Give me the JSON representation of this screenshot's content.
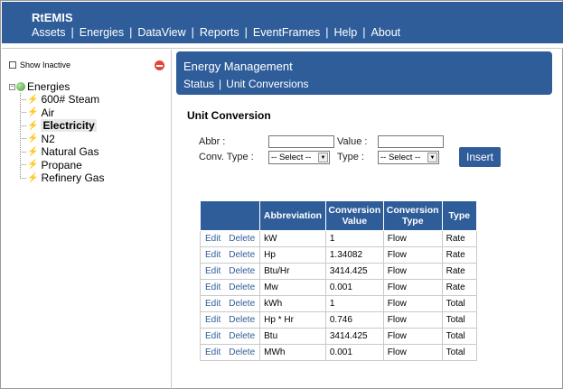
{
  "app": {
    "title": "RtEMIS",
    "nav": [
      "Assets",
      "Energies",
      "DataView",
      "Reports",
      "EventFrames",
      "Help",
      "About"
    ]
  },
  "sidebar": {
    "show_inactive_label": "Show Inactive",
    "tree_root": "Energies",
    "items": [
      "600# Steam",
      "Air",
      "Electricity",
      "N2",
      "Natural Gas",
      "Propane",
      "Refinery Gas"
    ],
    "selected": "Electricity"
  },
  "panel": {
    "title": "Energy Management",
    "links": [
      "Status",
      "Unit Conversions"
    ]
  },
  "form": {
    "section_title": "Unit Conversion",
    "abbr_label": "Abbr :",
    "value_label": "Value :",
    "conv_type_label": "Conv. Type :",
    "type_label": "Type :",
    "conv_type_selected": "-- Select --",
    "type_selected": "-- Select --",
    "insert_label": "Insert",
    "abbr_value": "",
    "value_value": ""
  },
  "table": {
    "headers": [
      "",
      "Abbreviation",
      "Conversion Value",
      "Conversion Type",
      "Type"
    ],
    "edit_label": "Edit",
    "delete_label": "Delete",
    "rows": [
      {
        "abbreviation": "kW",
        "value": "1",
        "conv_type": "Flow",
        "type": "Rate"
      },
      {
        "abbreviation": "Hp",
        "value": "1.34082",
        "conv_type": "Flow",
        "type": "Rate"
      },
      {
        "abbreviation": "Btu/Hr",
        "value": "3414.425",
        "conv_type": "Flow",
        "type": "Rate"
      },
      {
        "abbreviation": "Mw",
        "value": "0.001",
        "conv_type": "Flow",
        "type": "Rate"
      },
      {
        "abbreviation": "kWh",
        "value": "1",
        "conv_type": "Flow",
        "type": "Total"
      },
      {
        "abbreviation": "Hp * Hr",
        "value": "0.746",
        "conv_type": "Flow",
        "type": "Total"
      },
      {
        "abbreviation": "Btu",
        "value": "3414.425",
        "conv_type": "Flow",
        "type": "Total"
      },
      {
        "abbreviation": "MWh",
        "value": "0.001",
        "conv_type": "Flow",
        "type": "Total"
      }
    ]
  },
  "icons": {
    "tree_item": "lightning-bolt-icon",
    "tree_root": "globe-icon",
    "collapse": "collapse-icon"
  },
  "colors": {
    "brand": "#2f5d9a",
    "link": "#2f5d9a",
    "collapse": "#e0463a",
    "bolt": "#f0b21a"
  }
}
